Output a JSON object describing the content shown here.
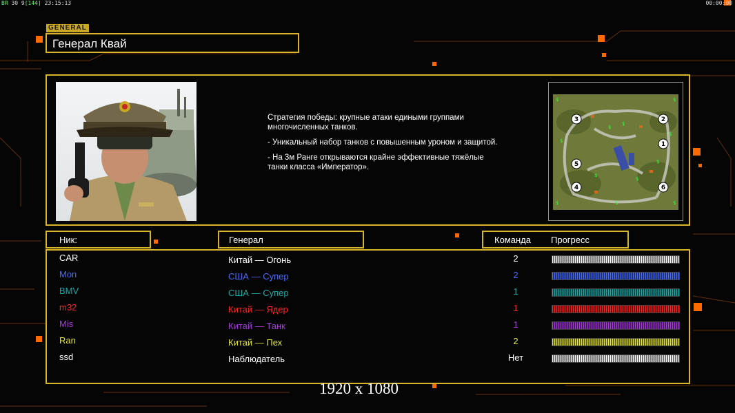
{
  "hud": {
    "left_tag": "BR",
    "left_info": "30 9",
    "left_code": "[144]",
    "left_time": "23:15:13",
    "right_time": "00:00:00"
  },
  "general": {
    "tag": "GENERAL",
    "name": "Генерал Квай",
    "description": [
      "Стратегия победы: крупные атаки едиными группами многочисленных танков.",
      "- Уникальный набор танков с повышенным уроном и защитой.",
      "- На 3м Ранге открываются крайне эффективные тяжёлые танки класса «Император»."
    ]
  },
  "minimap": {
    "positions": [
      "1",
      "2",
      "3",
      "4",
      "5",
      "6"
    ],
    "resource_icon": "dollar-icon"
  },
  "table": {
    "col_nick": "Ник:",
    "col_general": "Генерал",
    "col_team": "Команда",
    "col_progress": "Прогресс",
    "rows": [
      {
        "nick": "CAR",
        "general": "Китай — Огонь",
        "team": "2",
        "color": "#ffffff"
      },
      {
        "nick": "Mon",
        "general": "США — Супер",
        "team": "2",
        "color": "#4a6cff"
      },
      {
        "nick": "BMV",
        "general": "США — Супер",
        "team": "1",
        "color": "#1fa7a7"
      },
      {
        "nick": "m32",
        "general": "Китай — Ядер",
        "team": "1",
        "color": "#ff2222"
      },
      {
        "nick": "Mis",
        "general": "Китай — Танк",
        "team": "1",
        "color": "#a53ad8"
      },
      {
        "nick": "Ran",
        "general": "Китай — Пех",
        "team": "2",
        "color": "#e4e43a"
      },
      {
        "nick": "ssd",
        "general": "Наблюдатель",
        "team": "Нет",
        "color": "#ffffff"
      }
    ]
  },
  "resolution": "1920 x 1080",
  "colors": {
    "accent": "#d8b52a",
    "background": "#050505",
    "hud_orange": "#ff6a00"
  }
}
